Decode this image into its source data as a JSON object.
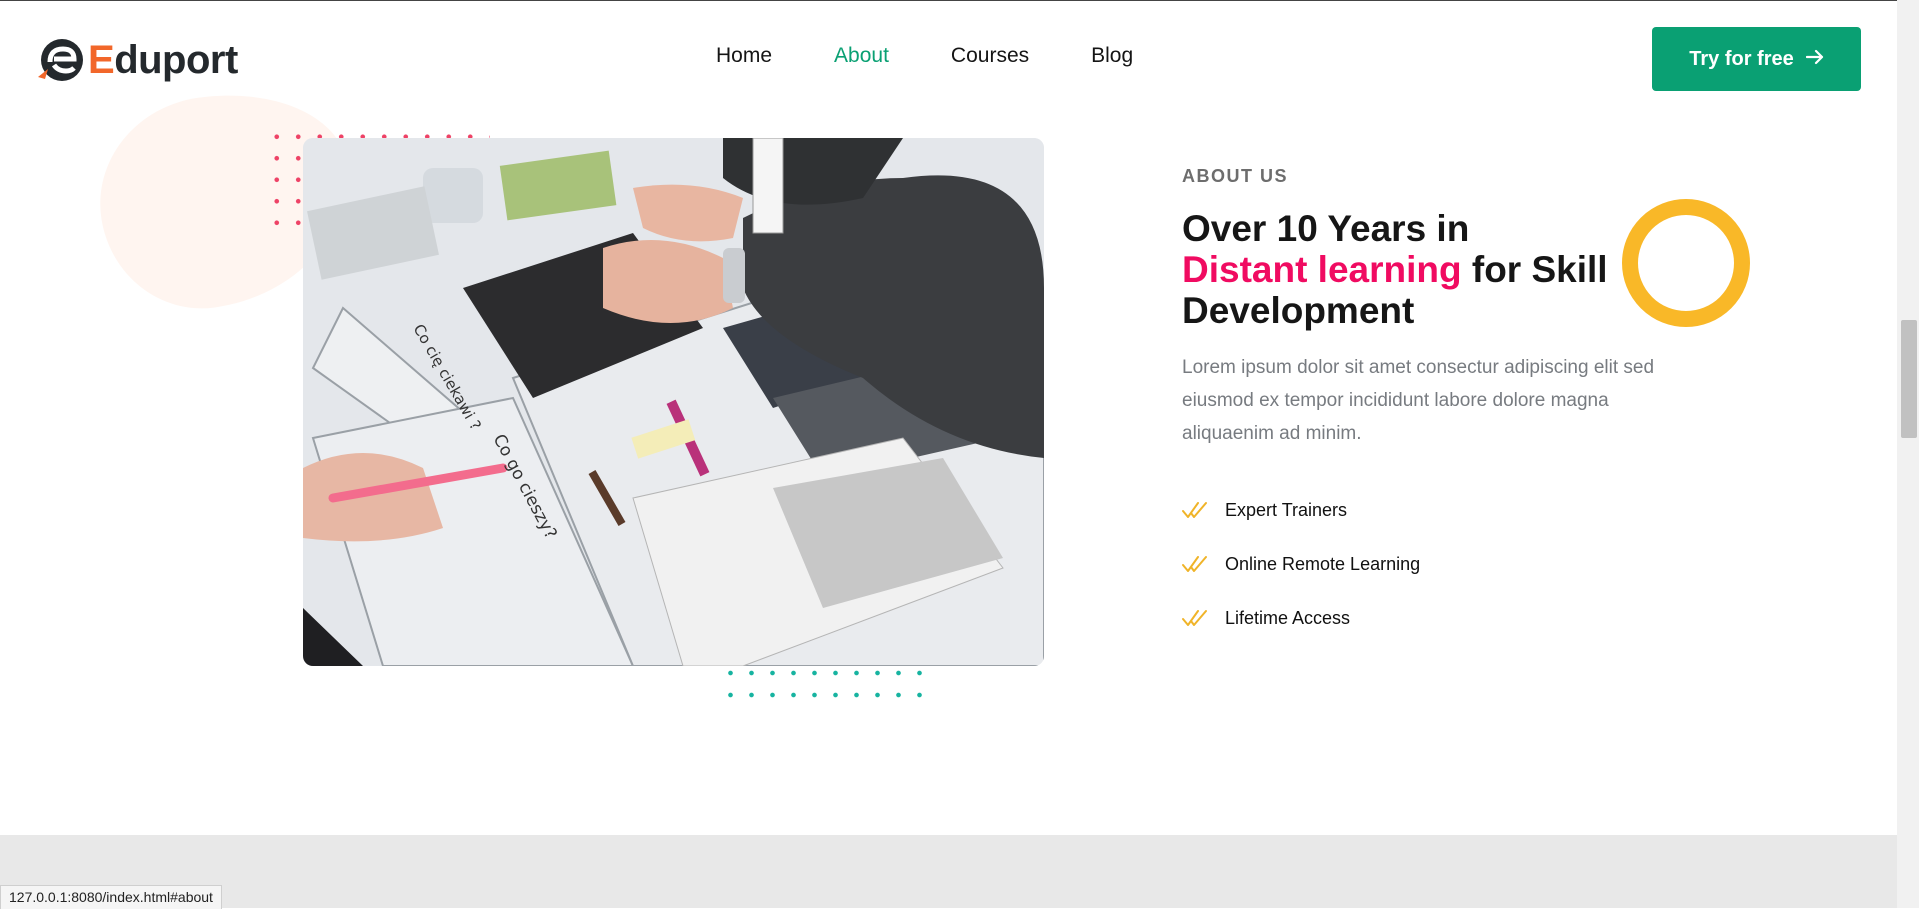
{
  "brand": {
    "name_first_letter": "E",
    "name_rest": "duport",
    "accent": "#f2672a"
  },
  "nav": {
    "items": [
      {
        "label": "Home",
        "active": false
      },
      {
        "label": "About",
        "active": true
      },
      {
        "label": "Courses",
        "active": false
      },
      {
        "label": "Blog",
        "active": false
      }
    ],
    "active_color": "#0aa073"
  },
  "cta": {
    "label": "Try for free",
    "icon": "arrow-right-icon",
    "color": "#0aa073"
  },
  "about": {
    "kicker": "ABOUT US",
    "title_line1": "Over 10 Years in",
    "title_highlight": "Distant learning",
    "title_rest": " for Skill Development",
    "highlight_color": "#f00b61",
    "description": "Lorem ipsum dolor sit amet consectur adipiscing elit sed eiusmod ex tempor incididunt labore dolore magna aliquaenim ad minim.",
    "features": [
      {
        "icon": "double-check-icon",
        "label": "Expert Trainers"
      },
      {
        "icon": "double-check-icon",
        "label": "Online Remote Learning"
      },
      {
        "icon": "double-check-icon",
        "label": "Lifetime Access"
      }
    ],
    "ring_color": "#f9b828"
  },
  "photo": {
    "handwriting_1": "Co cię ciekawi ?",
    "handwriting_2": "Co go cieszy?"
  },
  "status_bar": {
    "url": "127.0.0.1:8080/index.html#about"
  }
}
